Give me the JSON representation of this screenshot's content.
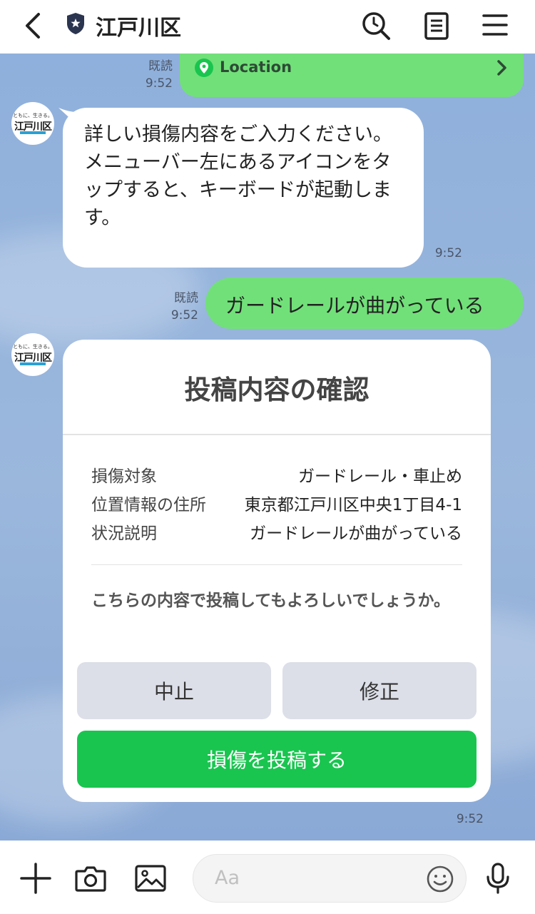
{
  "header": {
    "title": "江戸川区",
    "icons": [
      "back-arrow-icon",
      "shield-icon",
      "search-history-icon",
      "note-icon",
      "menu-icon"
    ]
  },
  "messages": [
    {
      "type": "location",
      "read_label": "既読",
      "time": "9:52",
      "label": "Location"
    },
    {
      "type": "bot_text",
      "text": "詳しい損傷内容をご入力ください。\nメニューバー左にあるアイコンをタップすると、キーボードが起動します。",
      "time": "9:52"
    },
    {
      "type": "user_text",
      "read_label": "既読",
      "time": "9:52",
      "text": "ガードレールが曲がっている"
    }
  ],
  "avatar": {
    "tagline": "ともに、生きる。",
    "logo": "江戸川区"
  },
  "card": {
    "title": "投稿内容の確認",
    "rows": [
      {
        "key": "損傷対象",
        "value": "ガードレール・車止め"
      },
      {
        "key": "位置情報の住所",
        "value": "東京都江戸川区中央1丁目4-1"
      },
      {
        "key": "状況説明",
        "value": "ガードレールが曲がっている"
      }
    ],
    "question": "こちらの内容で投稿してもよろしいでしょうか。",
    "cancel_label": "中止",
    "edit_label": "修正",
    "submit_label": "損傷を投稿する",
    "time": "9:52"
  },
  "input": {
    "placeholder": "Aa"
  },
  "colors": {
    "green_bubble": "#71e079",
    "submit_button": "#19c54f",
    "chat_bg": "#8fb0d9"
  }
}
